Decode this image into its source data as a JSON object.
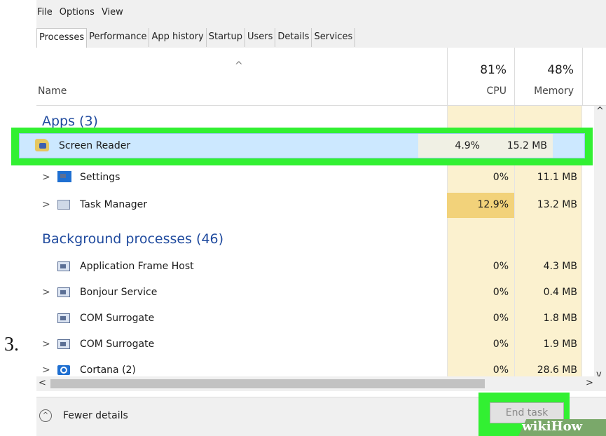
{
  "step_number": "3.",
  "menu": [
    "File",
    "Options",
    "View"
  ],
  "tabs": [
    "Processes",
    "Performance",
    "App history",
    "Startup",
    "Users",
    "Details",
    "Services"
  ],
  "header": {
    "name_label": "Name",
    "cpu_percent": "81%",
    "cpu_label": "CPU",
    "memory_percent": "48%",
    "memory_label": "Memory"
  },
  "groups": {
    "apps": "Apps (3)",
    "background": "Background processes (46)"
  },
  "apps": [
    {
      "name": "Screen Reader",
      "cpu": "4.9%",
      "memory": "15.2 MB",
      "icon": "screen-reader-icon"
    },
    {
      "name": "Settings",
      "cpu": "0%",
      "memory": "11.1 MB",
      "icon": "settings-icon"
    },
    {
      "name": "Task Manager",
      "cpu": "12.9%",
      "memory": "13.2 MB",
      "icon": "task-manager-icon"
    }
  ],
  "background": [
    {
      "name": "Application Frame Host",
      "cpu": "0%",
      "memory": "4.3 MB",
      "expandable": false
    },
    {
      "name": "Bonjour Service",
      "cpu": "0%",
      "memory": "0.4 MB",
      "expandable": true
    },
    {
      "name": "COM Surrogate",
      "cpu": "0%",
      "memory": "1.8 MB",
      "expandable": false
    },
    {
      "name": "COM Surrogate",
      "cpu": "0%",
      "memory": "1.9 MB",
      "expandable": true
    },
    {
      "name": "Cortana (2)",
      "cpu": "0%",
      "memory": "28.6 MB",
      "expandable": true
    }
  ],
  "footer": {
    "fewer_details": "Fewer details",
    "end_task": "End task"
  },
  "watermark": {
    "wiki": "wiki",
    "how": "How"
  },
  "colors": {
    "highlight_green": "#32f032",
    "selected_row": "#cce8ff",
    "heat_light": "#fbf1cf",
    "heat_medium": "#f2d27a",
    "group_blue": "#1f4a9e"
  }
}
